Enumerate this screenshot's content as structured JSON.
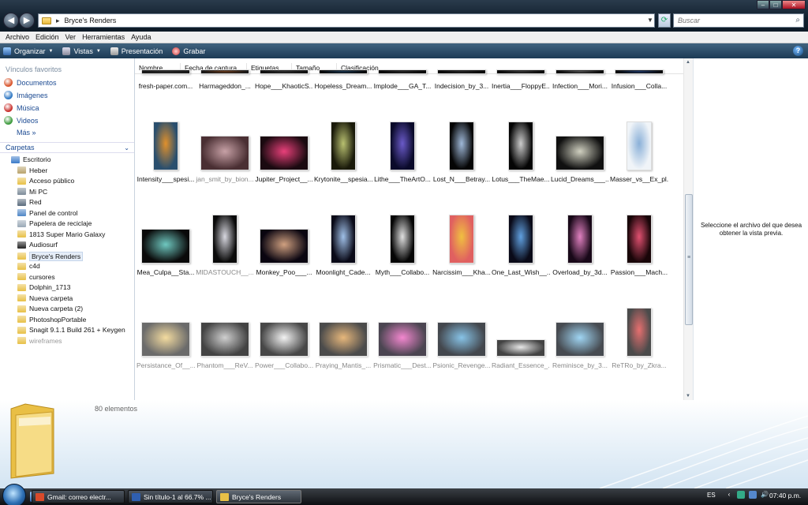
{
  "address_bar": {
    "path": "Bryce's Renders",
    "search_placeholder": "Buscar"
  },
  "menu": [
    "Archivo",
    "Edición",
    "Ver",
    "Herramientas",
    "Ayuda"
  ],
  "toolbar": {
    "organize": "Organizar",
    "views": "Vistas",
    "slideshow": "Presentación",
    "burn": "Grabar"
  },
  "nav": {
    "favorites_header": "Vínculos favoritos",
    "favorites": [
      {
        "label": "Documentos",
        "icon": "documents-icon",
        "color": "#d9542b"
      },
      {
        "label": "Imágenes",
        "icon": "pictures-icon",
        "color": "#2f78c4"
      },
      {
        "label": "Música",
        "icon": "music-icon",
        "color": "#c9302c"
      },
      {
        "label": "Videos",
        "icon": "videos-icon",
        "color": "#3c9a3c"
      }
    ],
    "more": "Más",
    "folders_header": "Carpetas",
    "tree": [
      {
        "label": "Escritorio",
        "icon": "desktop-icon",
        "color": "#3a7ac9",
        "indent": 0
      },
      {
        "label": "Heber",
        "icon": "user-folder-icon",
        "color": "#b9a36c",
        "indent": 1
      },
      {
        "label": "Acceso público",
        "icon": "public-folder-icon",
        "color": "#e8c046",
        "indent": 1
      },
      {
        "label": "Mi PC",
        "icon": "computer-icon",
        "color": "#7d8b99",
        "indent": 1
      },
      {
        "label": "Red",
        "icon": "network-icon",
        "color": "#5a6b7c",
        "indent": 1
      },
      {
        "label": "Panel de control",
        "icon": "control-panel-icon",
        "color": "#4f86c6",
        "indent": 1
      },
      {
        "label": "Papelera de reciclaje",
        "icon": "recycle-bin-icon",
        "color": "#9aa8b6",
        "indent": 1
      },
      {
        "label": "1813 Super Mario Galaxy",
        "icon": "folder-icon",
        "color": "#e8c046",
        "indent": 1
      },
      {
        "label": "Audiosurf",
        "icon": "app-icon",
        "color": "#222222",
        "indent": 1
      },
      {
        "label": "Bryce's Renders",
        "icon": "folder-icon",
        "color": "#e8c046",
        "indent": 1,
        "selected": true
      },
      {
        "label": "c4d",
        "icon": "folder-icon",
        "color": "#e8c046",
        "indent": 1
      },
      {
        "label": "cursores",
        "icon": "folder-icon",
        "color": "#e8c046",
        "indent": 1
      },
      {
        "label": "Dolphin_1713",
        "icon": "folder-icon",
        "color": "#e8c046",
        "indent": 1
      },
      {
        "label": "Nueva carpeta",
        "icon": "folder-icon",
        "color": "#e8c046",
        "indent": 1
      },
      {
        "label": "Nueva carpeta (2)",
        "icon": "folder-icon",
        "color": "#e8c046",
        "indent": 1
      },
      {
        "label": "PhotoshopPortable",
        "icon": "folder-icon",
        "color": "#e8c046",
        "indent": 1
      },
      {
        "label": "Snagit 9.1.1 Build 261 + Keygen",
        "icon": "folder-icon",
        "color": "#e8c046",
        "indent": 1
      },
      {
        "label": "wireframes",
        "icon": "folder-icon",
        "color": "#e8c046",
        "indent": 1,
        "faded": true
      }
    ]
  },
  "columns": [
    "Nombre",
    "Fecha de captura",
    "Etiquetas",
    "Tamaño",
    "Clasificación"
  ],
  "rows": [
    {
      "items": [
        {
          "name": "fresh-paper.com...",
          "c1": "#2c2c2c",
          "c2": "#1a1a1a",
          "shape": "wide"
        },
        {
          "name": "Harmageddon_...",
          "c1": "#6b3c1c",
          "c2": "#1a1a1a",
          "shape": "wide"
        },
        {
          "name": "Hope___KhaoticS...",
          "c1": "#333333",
          "c2": "#111111",
          "shape": "wide"
        },
        {
          "name": "Hopeless_Dream...",
          "c1": "#1d3a55",
          "c2": "#0a0a0a",
          "shape": "wide"
        },
        {
          "name": "Implode___GA_T...",
          "c1": "#2a2a2a",
          "c2": "#0a0a0a",
          "shape": "wide"
        },
        {
          "name": "Indecision_by_3...",
          "c1": "#2a2a2a",
          "c2": "#0a0a0a",
          "shape": "wide"
        },
        {
          "name": "Inertia___FloppyE...",
          "c1": "#3a3a3a",
          "c2": "#0a0a0a",
          "shape": "wide"
        },
        {
          "name": "Infection___Mori...",
          "c1": "#555555",
          "c2": "#0a0a0a",
          "shape": "wide"
        },
        {
          "name": "Infusion___Colla...",
          "c1": "#1f3a6b",
          "c2": "#0a0a0a",
          "shape": "wide"
        }
      ]
    },
    {
      "items": [
        {
          "name": "Intensity___spesi...",
          "c1": "#e0902c",
          "c2": "#2a4f6e",
          "shape": "tall"
        },
        {
          "name": "jan_smit_by_bion...",
          "c1": "#c7a1a6",
          "c2": "#4a2f33",
          "shape": "wide"
        },
        {
          "name": "Jupiter_Project__...",
          "c1": "#e8407a",
          "c2": "#1a0a10",
          "shape": "wide"
        },
        {
          "name": "Krytonite__spesia...",
          "c1": "#b8c070",
          "c2": "#1a1a0a",
          "shape": "tall"
        },
        {
          "name": "Lithe___TheArtO...",
          "c1": "#6a5ac8",
          "c2": "#0a0a2a",
          "shape": "tall"
        },
        {
          "name": "Lost_N___Betray...",
          "c1": "#9fb8d8",
          "c2": "#050505",
          "shape": "tall"
        },
        {
          "name": "Lotus___TheMae...",
          "c1": "#cccccc",
          "c2": "#050505",
          "shape": "tall"
        },
        {
          "name": "Lucid_Dreams___...",
          "c1": "#d0d0c0",
          "c2": "#101010",
          "shape": "wide"
        },
        {
          "name": "Masser_vs__Ex_pl...",
          "c1": "#8ab0d8",
          "c2": "#f0f4f8",
          "shape": "tall"
        }
      ]
    },
    {
      "items": [
        {
          "name": "Mea_Culpa__Sta...",
          "c1": "#6fc8c0",
          "c2": "#0a0a0a",
          "shape": "wide"
        },
        {
          "name": "MIDASTOUCH__...",
          "c1": "#d8d8e0",
          "c2": "#0a0a0a",
          "shape": "tall"
        },
        {
          "name": "Monkey_Poo___...",
          "c1": "#d0a080",
          "c2": "#0a0510",
          "shape": "wide"
        },
        {
          "name": "Moonlight_Cade...",
          "c1": "#a0c0e8",
          "c2": "#0a0a18",
          "shape": "tall"
        },
        {
          "name": "Myth___Collabo...",
          "c1": "#e0e0e0",
          "c2": "#050505",
          "shape": "tall"
        },
        {
          "name": "Narcissim___Kha...",
          "c1": "#f0c040",
          "c2": "#e06060",
          "shape": "tall"
        },
        {
          "name": "One_Last_Wish__...",
          "c1": "#60a0e0",
          "c2": "#0a0a18",
          "shape": "tall"
        },
        {
          "name": "Overload_by_3d...",
          "c1": "#e080c0",
          "c2": "#180818",
          "shape": "tall"
        },
        {
          "name": "Passion___Mach...",
          "c1": "#e05070",
          "c2": "#180508",
          "shape": "tall"
        }
      ]
    },
    {
      "items": [
        {
          "name": "Persistance_Of__...",
          "c1": "#f0d080",
          "c2": "#3a3a3a",
          "shape": "wide"
        },
        {
          "name": "Phantom___ReV...",
          "c1": "#c0c0c0",
          "c2": "#050505",
          "shape": "wide"
        },
        {
          "name": "Power___Collabo...",
          "c1": "#f0f0f0",
          "c2": "#0a0a0a",
          "shape": "wide"
        },
        {
          "name": "Praying_Mantis_...",
          "c1": "#e0a050",
          "c2": "#101010",
          "shape": "wide"
        },
        {
          "name": "Prismatic___Dest...",
          "c1": "#f060c0",
          "c2": "#100818",
          "shape": "wide"
        },
        {
          "name": "Psionic_Revenge...",
          "c1": "#60b0e0",
          "c2": "#050a12",
          "shape": "wide"
        },
        {
          "name": "Radiant_Essence_...",
          "c1": "#e0e0e0",
          "c2": "#050505",
          "shape": "wide-short"
        },
        {
          "name": "Reminisce_by_3...",
          "c1": "#80c8f0",
          "c2": "#0a1018",
          "shape": "wide"
        },
        {
          "name": "ReTRo_by_Zkra...",
          "c1": "#e04040",
          "c2": "#101010",
          "shape": "tall"
        }
      ]
    }
  ],
  "preview": {
    "message": "Seleccione el archivo del que desea obtener la vista previa."
  },
  "details": {
    "count": "80 elementos"
  },
  "taskbar": {
    "buttons": [
      {
        "label": "Gmail: correo electr...",
        "icon": "browser-icon",
        "color": "#d94a2a"
      },
      {
        "label": "Sin título-1 al 66.7% ...",
        "icon": "photoshop-icon",
        "color": "#2f5fb0"
      },
      {
        "label": "Bryce's Renders",
        "icon": "folder-icon",
        "color": "#e8c046",
        "active": true
      }
    ],
    "language": "ES",
    "clock": "07:40 p.m."
  }
}
